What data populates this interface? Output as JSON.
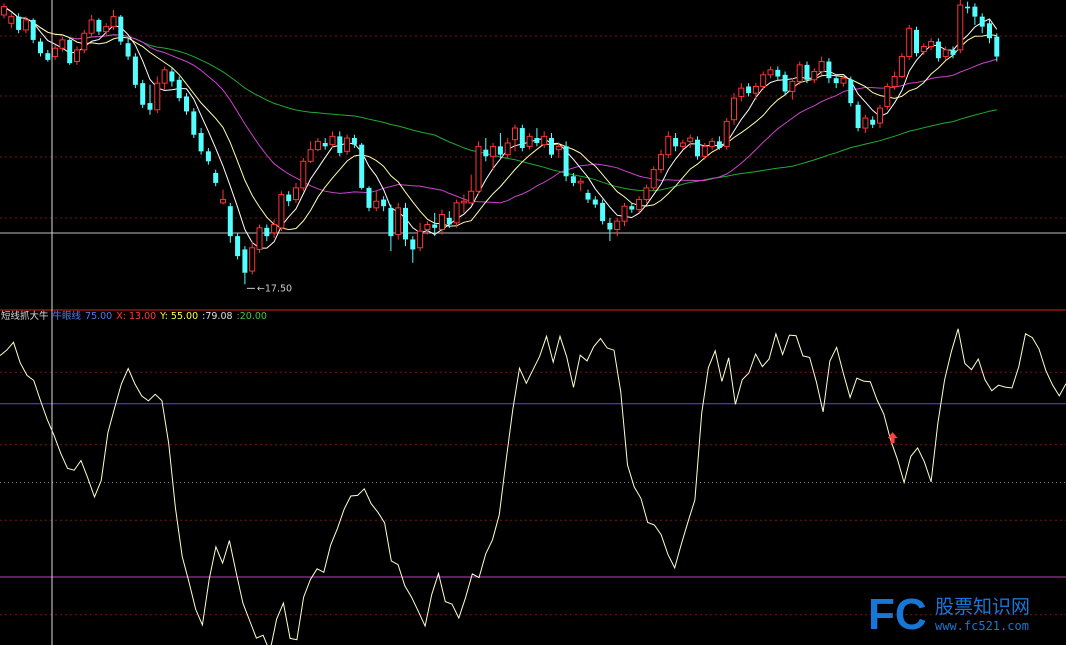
{
  "colors": {
    "background": "#000000",
    "candle_up": "#ff3232",
    "candle_down": "#54ffff",
    "ma_short": "#ffffff",
    "ma_mid": "#ffffaa",
    "ma_long1": "#cc44cc",
    "ma_long2": "#22aa33",
    "grid": "#7a1414",
    "price_line": "#bbbbbb",
    "indicator_line": "#ffffcc",
    "line_75": "#3d5bd8",
    "line_20": "#c040c0",
    "line_50": "#888888",
    "signal_arrow": "#ff4444",
    "watermark_blue": "#1677d6"
  },
  "price_panel": {
    "low_label": "17.50"
  },
  "indicator_panel": {
    "legend": [
      {
        "text": "短线抓大牛",
        "color": "#d8d8d8"
      },
      {
        "text": "牛眼线",
        "color": "#4f7be8"
      },
      {
        "text": "75.00",
        "color": "#4f7be8"
      },
      {
        "text": "X: 13.00",
        "color": "#ff3c3c"
      },
      {
        "text": "Y: 55.00",
        "color": "#ffff44"
      },
      {
        "text": ":79.08",
        "color": "#e0e0e0"
      },
      {
        "text": ":20.00",
        "color": "#40cc40"
      }
    ]
  },
  "watermark": {
    "logo": "FC",
    "site_name": "股票知识网",
    "url": "www.fc521.com"
  },
  "chart_data": [
    {
      "type": "candlestick",
      "title": "",
      "annotations": [
        "17.50"
      ],
      "ylim": [
        16.8,
        34.6
      ],
      "candles": [
        [
          33.7,
          34.2,
          34.4,
          33.5
        ],
        [
          33.2,
          33.6,
          33.8,
          32.9
        ],
        [
          33.6,
          32.8,
          33.8,
          32.6
        ],
        [
          32.8,
          33.4,
          33.6,
          32.6
        ],
        [
          33.4,
          32.2,
          33.5,
          32.0
        ],
        [
          32.1,
          31.4,
          32.3,
          31.2
        ],
        [
          31.4,
          31.0,
          31.6,
          30.9
        ],
        [
          31.2,
          31.7,
          31.9,
          31.0
        ],
        [
          31.7,
          32.2,
          32.4,
          31.5
        ],
        [
          32.2,
          30.8,
          32.3,
          30.7
        ],
        [
          30.9,
          31.6,
          31.8,
          30.7
        ],
        [
          31.6,
          32.6,
          32.8,
          31.4
        ],
        [
          32.6,
          33.4,
          33.7,
          32.4
        ],
        [
          33.4,
          32.7,
          33.5,
          32.5
        ],
        [
          32.7,
          33.0,
          33.2,
          32.5
        ],
        [
          33.0,
          33.6,
          34.0,
          32.8
        ],
        [
          33.6,
          32.1,
          33.7,
          31.9
        ],
        [
          32.0,
          31.2,
          32.3,
          31.0
        ],
        [
          31.2,
          29.5,
          31.4,
          29.3
        ],
        [
          29.6,
          28.3,
          29.8,
          28.1
        ],
        [
          28.4,
          28.0,
          29.5,
          27.7
        ],
        [
          28.0,
          29.6,
          30.0,
          27.8
        ],
        [
          29.6,
          30.4,
          30.6,
          29.2
        ],
        [
          30.3,
          29.7,
          30.5,
          29.4
        ],
        [
          29.8,
          28.7,
          30.0,
          28.5
        ],
        [
          28.8,
          27.9,
          29.0,
          27.7
        ],
        [
          27.9,
          26.5,
          28.1,
          26.3
        ],
        [
          26.6,
          25.5,
          26.9,
          25.3
        ],
        [
          25.5,
          24.9,
          25.7,
          24.7
        ],
        [
          24.2,
          23.6,
          24.4,
          23.4
        ],
        [
          22.4,
          22.6,
          23.2,
          22.3
        ],
        [
          22.2,
          20.4,
          22.4,
          20.0
        ],
        [
          20.4,
          19.2,
          20.6,
          19.0
        ],
        [
          19.6,
          18.2,
          19.8,
          17.5
        ],
        [
          18.3,
          19.7,
          20.1,
          18.1
        ],
        [
          19.6,
          20.9,
          21.1,
          19.4
        ],
        [
          20.9,
          20.4,
          21.1,
          20.1
        ],
        [
          20.6,
          21.1,
          21.4,
          20.3
        ],
        [
          20.9,
          22.9,
          23.1,
          20.7
        ],
        [
          22.9,
          22.5,
          23.1,
          22.2
        ],
        [
          22.6,
          23.3,
          23.6,
          22.4
        ],
        [
          23.3,
          24.9,
          25.1,
          23.1
        ],
        [
          24.9,
          25.6,
          26.1,
          24.8
        ],
        [
          25.6,
          26.1,
          26.3,
          25.5
        ],
        [
          26.0,
          25.8,
          26.3,
          25.6
        ],
        [
          25.9,
          26.4,
          26.7,
          25.7
        ],
        [
          26.4,
          25.4,
          26.7,
          25.2
        ],
        [
          25.5,
          26.3,
          26.5,
          25.3
        ],
        [
          26.3,
          25.9,
          26.5,
          25.7
        ],
        [
          25.9,
          23.3,
          26.0,
          23.2
        ],
        [
          23.3,
          22.1,
          23.4,
          21.9
        ],
        [
          22.1,
          22.5,
          23.1,
          21.9
        ],
        [
          22.6,
          22.2,
          22.8,
          21.9
        ],
        [
          22.1,
          20.4,
          22.3,
          19.5
        ],
        [
          20.5,
          22.1,
          22.4,
          20.2
        ],
        [
          22.1,
          20.2,
          22.4,
          19.8
        ],
        [
          20.2,
          19.6,
          20.4,
          18.8
        ],
        [
          19.7,
          20.7,
          21.2,
          19.5
        ],
        [
          20.8,
          21.1,
          21.3,
          20.5
        ],
        [
          21.1,
          20.9,
          21.8,
          20.4
        ],
        [
          20.8,
          21.7,
          22.0,
          20.5
        ],
        [
          21.5,
          21.1,
          21.9,
          20.9
        ],
        [
          21.2,
          22.4,
          22.6,
          20.9
        ],
        [
          22.4,
          22.5,
          22.9,
          21.8
        ],
        [
          22.4,
          23.1,
          24.1,
          22.3
        ],
        [
          23.1,
          25.8,
          26.1,
          22.9
        ],
        [
          25.6,
          25.2,
          26.3,
          24.9
        ],
        [
          25.2,
          25.8,
          26.0,
          24.4
        ],
        [
          25.8,
          25.3,
          26.6,
          25.1
        ],
        [
          25.3,
          26.0,
          26.3,
          25.1
        ],
        [
          26.2,
          26.9,
          27.1,
          25.5
        ],
        [
          26.9,
          25.7,
          27.1,
          25.5
        ],
        [
          25.8,
          26.4,
          26.6,
          25.6
        ],
        [
          26.3,
          26.0,
          26.9,
          25.8
        ],
        [
          25.9,
          26.4,
          26.7,
          25.7
        ],
        [
          26.3,
          25.3,
          26.6,
          25.1
        ],
        [
          25.6,
          25.8,
          26.0,
          25.1
        ],
        [
          25.8,
          24.0,
          26.1,
          23.7
        ],
        [
          24.0,
          23.6,
          24.2,
          23.4
        ],
        [
          23.6,
          23.7,
          23.9,
          23.1
        ],
        [
          23.0,
          22.6,
          23.2,
          22.4
        ],
        [
          22.6,
          22.3,
          22.8,
          22.1
        ],
        [
          22.4,
          21.3,
          22.6,
          21.1
        ],
        [
          21.2,
          20.8,
          21.5,
          20.1
        ],
        [
          20.8,
          21.3,
          21.5,
          20.4
        ],
        [
          21.3,
          22.2,
          22.4,
          21.0
        ],
        [
          22.2,
          22.0,
          22.4,
          21.8
        ],
        [
          22.0,
          22.6,
          22.8,
          21.8
        ],
        [
          22.6,
          23.3,
          23.5,
          22.4
        ],
        [
          23.3,
          24.4,
          24.6,
          23.1
        ],
        [
          24.4,
          25.3,
          25.6,
          24.2
        ],
        [
          25.3,
          26.4,
          26.7,
          25.1
        ],
        [
          26.3,
          25.8,
          26.6,
          25.5
        ],
        [
          25.8,
          26.0,
          26.2,
          25.6
        ],
        [
          26.1,
          26.3,
          26.5,
          25.7
        ],
        [
          26.2,
          25.2,
          26.4,
          25.0
        ],
        [
          25.2,
          25.8,
          26.0,
          25.0
        ],
        [
          25.8,
          26.1,
          26.3,
          25.6
        ],
        [
          26.1,
          25.7,
          26.4,
          25.6
        ],
        [
          25.8,
          27.3,
          27.5,
          25.6
        ],
        [
          27.4,
          28.7,
          29.0,
          27.1
        ],
        [
          28.8,
          29.3,
          29.6,
          28.5
        ],
        [
          29.4,
          29.0,
          29.6,
          28.8
        ],
        [
          29.0,
          29.4,
          29.6,
          28.6
        ],
        [
          29.4,
          30.1,
          30.3,
          29.2
        ],
        [
          30.1,
          30.4,
          30.6,
          29.9
        ],
        [
          30.4,
          30.0,
          30.6,
          29.8
        ],
        [
          30.1,
          29.1,
          30.3,
          28.9
        ],
        [
          29.1,
          29.7,
          29.9,
          28.6
        ],
        [
          29.7,
          30.7,
          30.9,
          29.5
        ],
        [
          30.7,
          29.8,
          30.9,
          29.6
        ],
        [
          29.8,
          30.3,
          30.5,
          29.6
        ],
        [
          30.3,
          30.9,
          31.2,
          30.1
        ],
        [
          30.9,
          29.9,
          31.1,
          29.6
        ],
        [
          29.9,
          29.6,
          30.1,
          29.3
        ],
        [
          29.6,
          29.9,
          30.1,
          29.4
        ],
        [
          29.8,
          28.4,
          30.0,
          28.2
        ],
        [
          28.3,
          26.9,
          28.5,
          26.7
        ],
        [
          26.9,
          27.5,
          27.7,
          26.6
        ],
        [
          27.4,
          27.1,
          27.6,
          26.9
        ],
        [
          27.2,
          28.1,
          28.3,
          26.9
        ],
        [
          28.2,
          29.4,
          29.6,
          28.0
        ],
        [
          29.4,
          30.0,
          30.3,
          29.2
        ],
        [
          30.0,
          31.2,
          31.4,
          29.9
        ],
        [
          31.2,
          32.9,
          33.1,
          31.0
        ],
        [
          32.8,
          31.4,
          33.0,
          31.2
        ],
        [
          31.5,
          31.8,
          32.0,
          31.3
        ],
        [
          31.8,
          32.1,
          32.3,
          31.6
        ],
        [
          32.1,
          31.1,
          32.3,
          30.9
        ],
        [
          31.2,
          31.6,
          31.8,
          31.0
        ],
        [
          31.6,
          31.3,
          31.8,
          31.1
        ],
        [
          31.6,
          34.3,
          34.6,
          31.4
        ],
        [
          34.2,
          34.1,
          34.5,
          33.8
        ],
        [
          34.2,
          33.6,
          34.4,
          33.1
        ],
        [
          33.6,
          33.0,
          33.8,
          32.6
        ],
        [
          33.2,
          32.3,
          33.4,
          32.0
        ],
        [
          32.4,
          31.2,
          32.6,
          30.9
        ]
      ]
    },
    {
      "type": "line",
      "title": "",
      "legend": [
        "短线抓大牛",
        "牛眼线",
        "75.00",
        "X: 13.00",
        "Y: 55.00",
        ":79.08",
        ":20.00"
      ],
      "ylim": [
        0,
        100
      ],
      "reference_lines": [
        75,
        50,
        20
      ],
      "signal_arrow_index": 132,
      "values": [
        90.3,
        92.0,
        94.5,
        88.0,
        84.0,
        82.4,
        76.0,
        70.0,
        65.0,
        59.3,
        54.5,
        53.9,
        57.0,
        51.5,
        45.4,
        50.6,
        65.8,
        73.8,
        81.3,
        86.2,
        81.3,
        77.5,
        75.9,
        78.0,
        76.0,
        62.4,
        42.0,
        26.5,
        18.5,
        9.7,
        4.8,
        19.3,
        29.6,
        24.4,
        31.6,
        21.5,
        11.7,
        6.2,
        0.6,
        1.5,
        -3.7,
        6.6,
        11.7,
        0.5,
        0.1,
        13.6,
        19.2,
        22.6,
        21.5,
        30.1,
        35.3,
        41.5,
        45.7,
        45.9,
        48.0,
        43.3,
        40.6,
        37.2,
        25.1,
        23.9,
        17.2,
        13.6,
        9.1,
        4.4,
        14.5,
        21.1,
        12.2,
        11.4,
        7.0,
        13.4,
        21.0,
        19.8,
        27.4,
        31.8,
        39.8,
        56.8,
        73.2,
        86.3,
        81.5,
        85.8,
        90.1,
        96.4,
        88.2,
        96.4,
        89.9,
        80.2,
        90.4,
        88.6,
        93.1,
        95.7,
        92.7,
        92.0,
        78.9,
        55.6,
        48.6,
        45.0,
        37.3,
        36.5,
        33.4,
        27.2,
        22.9,
        30.5,
        37.7,
        44.5,
        72.0,
        86.5,
        91.8,
        82.1,
        89.6,
        74.8,
        82.6,
        84.8,
        90.8,
        86.8,
        89.2,
        97.2,
        90.6,
        96.8,
        96.6,
        90.2,
        89.7,
        81.9,
        72.4,
        88.6,
        92.9,
        84.6,
        77.0,
        83.1,
        82.2,
        82.0,
        76.2,
        71.7,
        63.5,
        57.5,
        50.0,
        58.3,
        61.0,
        56.6,
        50.2,
        68.7,
        82.6,
        91.5,
        98.8,
        87.8,
        85.8,
        89.2,
        82.6,
        79.1,
        80.9,
        80.3,
        80.0,
        86.8,
        97.2,
        96.0,
        92.4,
        85.6,
        81.0,
        77.5,
        81.4
      ]
    }
  ]
}
